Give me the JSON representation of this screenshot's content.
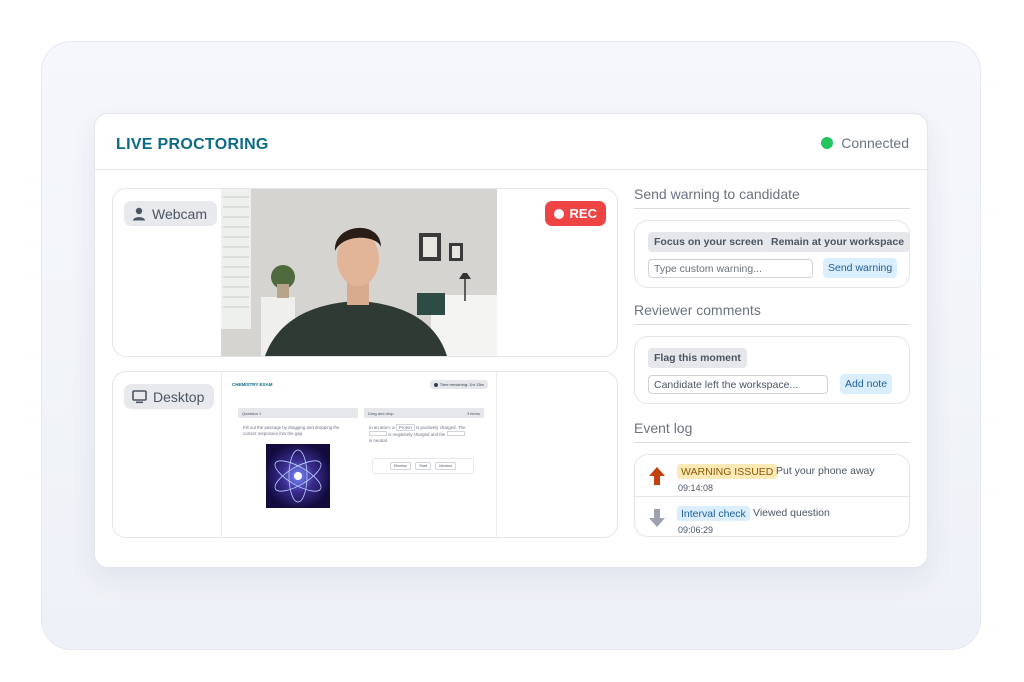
{
  "header": {
    "title": "LIVE PROCTORING",
    "status": "Connected",
    "status_color": "#22c55e"
  },
  "webcam": {
    "label": "Webcam",
    "icon": "user-icon",
    "rec_label": "REC",
    "rec_color": "#ef4444"
  },
  "desktop": {
    "label": "Desktop",
    "icon": "monitor-icon",
    "screen": {
      "exam_title": "CHEMISTRY EXAM",
      "time_remaining": "Time remaining: 1hr 15m",
      "question_header": "Question 1",
      "question_text": "Fill out the passage by dragging and dropping the correct responses into the gap.",
      "dnd_header": "Drag and drop",
      "dnd_count": "3 items",
      "passage_1": "In an atom, a",
      "chip_proton": "Proton",
      "passage_2": "is positively charged. The",
      "passage_3": "is negatively charged and the",
      "passage_4": "is neutral.",
      "options": [
        "Electron",
        "Shell",
        "Neutron"
      ]
    }
  },
  "warning": {
    "title": "Send warning to candidate",
    "presets": [
      "Focus on your screen",
      "Remain at your workspace"
    ],
    "input_placeholder": "Type custom warning...",
    "send_label": "Send warning"
  },
  "comments": {
    "title": "Reviewer comments",
    "flag_label": "Flag this moment",
    "input_value": "Candidate left the workspace...",
    "add_label": "Add note"
  },
  "event_log": {
    "title": "Event log",
    "events": [
      {
        "badge": "WARNING ISSUED",
        "type": "warn",
        "message": "Put your phone away",
        "time": "09:14:08",
        "icon": "arrow-up-icon"
      },
      {
        "badge": "Interval check",
        "type": "info",
        "message": "Viewed question",
        "time": "09:06:29",
        "icon": "arrow-down-icon"
      }
    ]
  }
}
